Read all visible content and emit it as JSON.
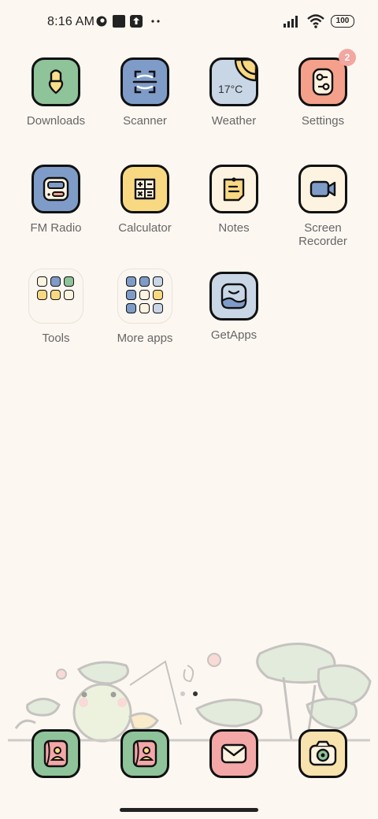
{
  "status_bar": {
    "time": "8:16 AM",
    "battery": "100"
  },
  "apps": [
    {
      "name": "Downloads",
      "color": "#8fc39a"
    },
    {
      "name": "Scanner",
      "color": "#7f9cc8"
    },
    {
      "name": "Weather",
      "color": "#c8d6e6",
      "temp": "17°C"
    },
    {
      "name": "Settings",
      "color": "#f4a08a",
      "badge": "2"
    },
    {
      "name": "FM Radio",
      "color": "#7f9cc8"
    },
    {
      "name": "Calculator",
      "color": "#f8d982"
    },
    {
      "name": "Notes",
      "color": "#fdf3e1"
    },
    {
      "name": "Screen Recorder",
      "color": "#fdf3e1"
    },
    {
      "name": "Tools"
    },
    {
      "name": "More apps"
    },
    {
      "name": "GetApps",
      "color": "#c8d6e6"
    }
  ],
  "dock": [
    {
      "name": "contacts-icon",
      "color": "#8fc39a"
    },
    {
      "name": "phone-contacts-icon",
      "color": "#8fc39a"
    },
    {
      "name": "mail-icon",
      "color": "#f4a7a7"
    },
    {
      "name": "camera-icon",
      "color": "#f8e2ad"
    }
  ]
}
